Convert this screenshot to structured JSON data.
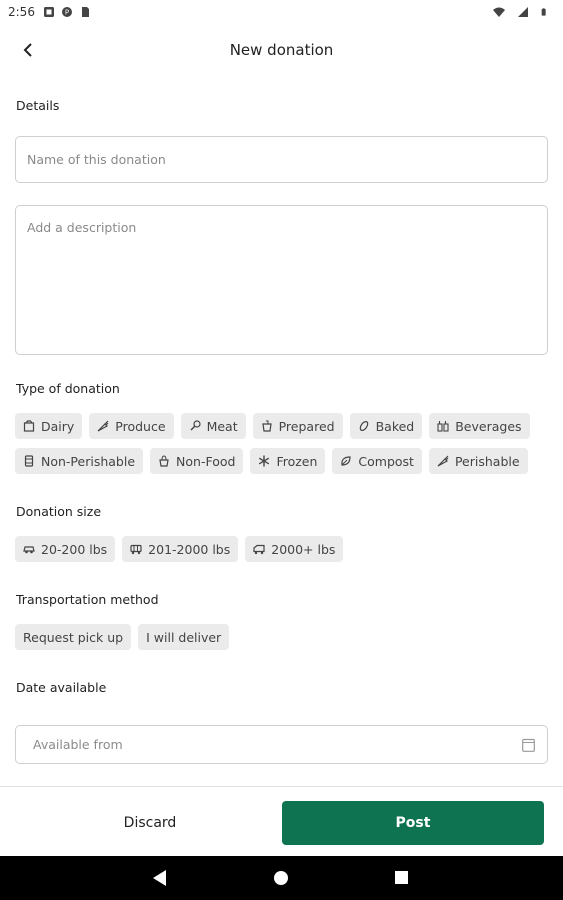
{
  "status_bar": {
    "time": "2:56",
    "icons_left": [
      "notification-a-icon",
      "notification-p-icon",
      "sim-card-icon"
    ],
    "icons_right": [
      "wifi-icon",
      "signal-icon",
      "battery-icon"
    ]
  },
  "app_bar": {
    "title": "New donation",
    "back_icon": "arrow-back-icon"
  },
  "details": {
    "label": "Details",
    "name_placeholder": "Name of this donation",
    "description_placeholder": "Add a description"
  },
  "type_of_donation": {
    "label": "Type of donation",
    "row1": [
      {
        "label": "Dairy",
        "icon": "dairy-icon"
      },
      {
        "label": "Produce",
        "icon": "carrot-icon"
      },
      {
        "label": "Meat",
        "icon": "drumstick-icon"
      },
      {
        "label": "Prepared",
        "icon": "pot-icon"
      },
      {
        "label": "Baked",
        "icon": "bread-icon"
      },
      {
        "label": "Beverages",
        "icon": "bottles-icon"
      }
    ],
    "row2": [
      {
        "label": "Non-Perishable",
        "icon": "can-icon"
      },
      {
        "label": "Non-Food",
        "icon": "bag-icon"
      },
      {
        "label": "Frozen",
        "icon": "snowflake-icon"
      },
      {
        "label": "Compost",
        "icon": "leaf-icon"
      },
      {
        "label": "Perishable",
        "icon": "carrot-icon"
      }
    ]
  },
  "donation_size": {
    "label": "Donation size",
    "options": [
      {
        "label": "20-200 lbs",
        "icon": "car-icon"
      },
      {
        "label": "201-2000 lbs",
        "icon": "van-icon"
      },
      {
        "label": "2000+ lbs",
        "icon": "truck-icon"
      }
    ]
  },
  "transportation": {
    "label": "Transportation method",
    "options": [
      "Request pick up",
      "I will deliver"
    ]
  },
  "date_available": {
    "label": "Date available",
    "placeholder": "Available from",
    "icon": "calendar-icon"
  },
  "footer": {
    "discard_label": "Discard",
    "post_label": "Post"
  },
  "colors": {
    "primary": "#0e7350",
    "chip_bg": "#ebebeb",
    "border": "#cfcfcf"
  }
}
